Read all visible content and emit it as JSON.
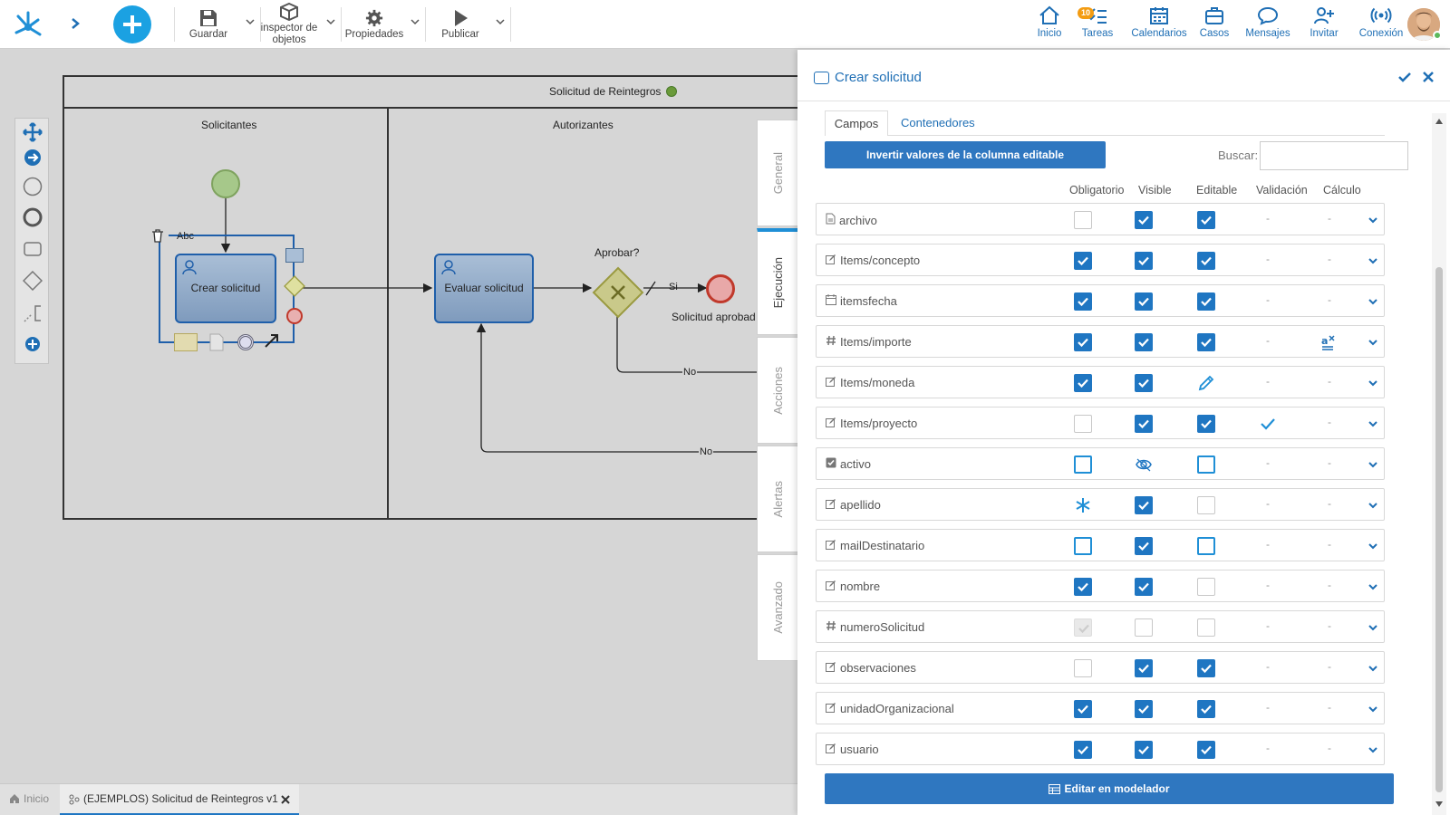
{
  "toolbar": {
    "save": "Guardar",
    "inspector_line1": "inspector de",
    "inspector_line2": "objetos",
    "properties": "Propiedades",
    "publish": "Publicar"
  },
  "nav": {
    "home": "Inicio",
    "tasks": "Tareas",
    "tasks_badge": "10",
    "calendars": "Calendarios",
    "cases": "Casos",
    "messages": "Mensajes",
    "invite": "Invitar",
    "connection": "Conexión"
  },
  "diagram": {
    "pool_title": "Solicitud de Reintegros",
    "lane_1": "Solicitantes",
    "lane_2": "Autorizantes",
    "task_1": "Crear solicitud",
    "task_2": "Evaluar solicitud",
    "gateway_label": "Aprobar?",
    "end_label": "Solicitud aprobad",
    "flow_si": "Si",
    "flow_no_1": "No",
    "flow_no_2": "No",
    "text_annotation": "Abc"
  },
  "panel": {
    "title": "Crear solicitud",
    "tabs_vertical": [
      "General",
      "Ejecución",
      "Acciones",
      "Alertas",
      "Avanzado"
    ],
    "subtabs": [
      "Campos",
      "Contenedores"
    ],
    "invert_button": "Invertir valores de la columna editable",
    "search_label": "Buscar:",
    "search_value": "",
    "columns": [
      "Obligatorio",
      "Visible",
      "Editable",
      "Validación",
      "Cálculo"
    ],
    "edit_button": "Editar en modelador",
    "rows": [
      {
        "name": "archivo",
        "icon": "file-icon",
        "obl": "off",
        "vis": "on",
        "edi": "on",
        "val": "-",
        "calc": "-"
      },
      {
        "name": "Items/concepto",
        "icon": "edit-icon",
        "obl": "on",
        "vis": "on",
        "edi": "on",
        "val": "-",
        "calc": "-"
      },
      {
        "name": "itemsfecha",
        "icon": "calendar-icon",
        "obl": "on",
        "vis": "on",
        "edi": "on",
        "val": "-",
        "calc": "-"
      },
      {
        "name": "Items/importe",
        "icon": "hash-icon",
        "obl": "on",
        "vis": "on",
        "edi": "on",
        "val": "-",
        "calc": "formula"
      },
      {
        "name": "Items/moneda",
        "icon": "edit-icon",
        "obl": "on",
        "vis": "on",
        "edi": "pencil",
        "val": "-",
        "calc": "-"
      },
      {
        "name": "Items/proyecto",
        "icon": "edit-icon",
        "obl": "off",
        "vis": "on",
        "edi": "on",
        "val": "check",
        "calc": "-"
      },
      {
        "name": "activo",
        "icon": "checkbox-icon",
        "obl": "ob",
        "vis": "eye",
        "edi": "ob",
        "val": "-",
        "calc": "-"
      },
      {
        "name": "apellido",
        "icon": "edit-icon",
        "obl": "asterisk",
        "vis": "on",
        "edi": "off",
        "val": "-",
        "calc": "-"
      },
      {
        "name": "mailDestinatario",
        "icon": "edit-icon",
        "obl": "ob",
        "vis": "on",
        "edi": "ob",
        "val": "-",
        "calc": "-"
      },
      {
        "name": "nombre",
        "icon": "edit-icon",
        "obl": "on",
        "vis": "on",
        "edi": "off",
        "val": "-",
        "calc": "-"
      },
      {
        "name": "numeroSolicitud",
        "icon": "hash-icon",
        "obl": "dis",
        "vis": "off",
        "edi": "off",
        "val": "-",
        "calc": "-"
      },
      {
        "name": "observaciones",
        "icon": "edit-icon",
        "obl": "off",
        "vis": "on",
        "edi": "on",
        "val": "-",
        "calc": "-"
      },
      {
        "name": "unidadOrganizacional",
        "icon": "edit-icon",
        "obl": "on",
        "vis": "on",
        "edi": "on",
        "val": "-",
        "calc": "-"
      },
      {
        "name": "usuario",
        "icon": "edit-icon",
        "obl": "on",
        "vis": "on",
        "edi": "on",
        "val": "-",
        "calc": "-"
      }
    ]
  },
  "bottom": {
    "home_tab": "Inicio",
    "doc_tab": "(EJEMPLOS) Solicitud de Reintegros v1"
  }
}
